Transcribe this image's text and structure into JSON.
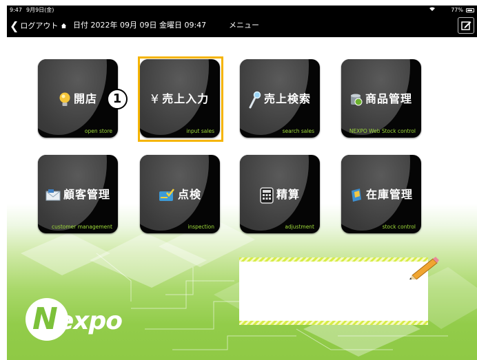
{
  "status_bar": {
    "time": "9:47",
    "date": "9月9日(金)",
    "battery": "77%"
  },
  "nav": {
    "back_label": "ログアウト",
    "dateline": "日付 2022年 09月 09日 金曜日 09:47",
    "title": "メニュー"
  },
  "tiles": [
    {
      "label": "開店",
      "sub": "open store",
      "icon": "lightbulb-icon"
    },
    {
      "label": "売上入力",
      "sub": "input sales",
      "icon": "yen-icon",
      "highlighted": true
    },
    {
      "label": "売上検索",
      "sub": "search sales",
      "icon": "magnifier-icon"
    },
    {
      "label": "商品管理",
      "sub": "NEXPO Web Stock control",
      "icon": "database-icon"
    },
    {
      "label": "顧客管理",
      "sub": "customer management",
      "icon": "mail-icon"
    },
    {
      "label": "点検",
      "sub": "inspection",
      "icon": "check-card-icon"
    },
    {
      "label": "精算",
      "sub": "adjustment",
      "icon": "calculator-icon"
    },
    {
      "label": "在庫管理",
      "sub": "stock control",
      "icon": "stock-icon"
    }
  ],
  "step_badge": "1",
  "logo": {
    "first": "N",
    "rest": "expo"
  },
  "colors": {
    "highlight": "#f5b400",
    "accent_green": "#9fdc3a",
    "note_stripe": "#d7ec47"
  }
}
